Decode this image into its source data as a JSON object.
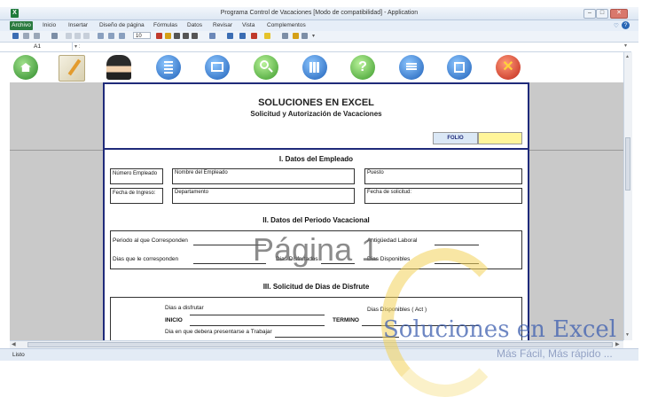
{
  "window": {
    "title": "Programa Control de Vacaciones  [Modo de compatibilidad]  -  Application",
    "app_icon_letter": "X"
  },
  "ribbon_tabs": [
    "Archivo",
    "Inicio",
    "Insertar",
    "Diseño de página",
    "Fórmulas",
    "Datos",
    "Revisar",
    "Vista",
    "Complementos"
  ],
  "formula_bar": {
    "name_box": "A1",
    "font_size": "10"
  },
  "toolbar_icons": [
    "home-icon",
    "notepad-icon",
    "employee-icon",
    "calculator-icon",
    "window-icon",
    "search-icon",
    "grid-icon",
    "help-icon",
    "stack-icon",
    "save-icon",
    "close-icon"
  ],
  "colors": {
    "frame_blue": "#1f2a7a",
    "gray_area": "#c9c9c9",
    "folio_bg": "#fff59a",
    "folio_label_bg": "#dbe8f6",
    "watermark_blue": "#3e5fb0",
    "archivo_green": "#2a7a3f"
  },
  "form": {
    "company": "SOLUCIONES EN EXCEL",
    "subtitle": "Solicitud y Autorización de Vacaciones",
    "folio_label": "FOLIO",
    "sec1_title": "I. Datos del Empleado",
    "numero_empleado": "Número Empleado",
    "nombre_empleado": "Nombre del Empleado",
    "puesto": "Puesto",
    "fecha_ingreso": "Fecha de Ingreso:",
    "departamento": "Departamento",
    "fecha_solicitud": "Fecha de solicitud:",
    "sec2_title": "II. Datos del Periodo Vacacional",
    "periodo_corresponden": "Periodo al que Corresponden",
    "antiguedad": "Antigüedad Laboral",
    "dias_corresponde": "Dias que le corresponden",
    "dias_disfrutados": "Dias Disfrutados",
    "dias_disponibles": "Dias Disponibles",
    "sec3_title": "III. Solicitud de Dias de Disfrute",
    "dias_disfrutar": "Dias a disfrutar",
    "dias_disponibles_act": "Dias Disponibles ( Act )",
    "inicio": "INICIO",
    "termino": "TERMINO",
    "dia_presentarse": "Dia en que debera presentarse a Trabajar"
  },
  "page_watermark": "Página 1",
  "status": "Listo",
  "brand_watermark": {
    "title": "Soluciones en Excel",
    "tagline": "Más Fácil, Más rápido ..."
  }
}
